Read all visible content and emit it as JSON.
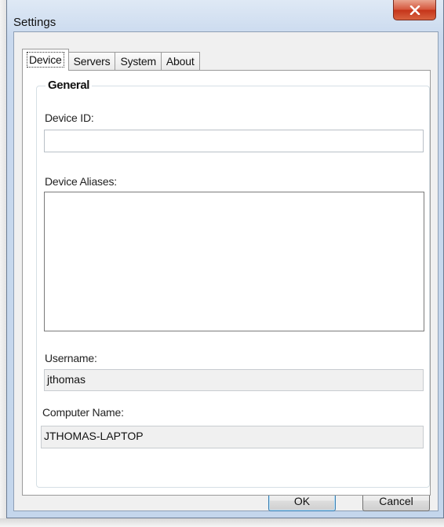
{
  "window": {
    "title": "Settings"
  },
  "tabs": [
    {
      "label": "Device",
      "active": true
    },
    {
      "label": "Servers",
      "active": false
    },
    {
      "label": "System",
      "active": false
    },
    {
      "label": "About",
      "active": false
    }
  ],
  "general": {
    "legend": "General",
    "device_id": {
      "label": "Device ID:",
      "value": ""
    },
    "device_aliases": {
      "label": "Device Aliases:",
      "value": ""
    },
    "username": {
      "label": "Username:",
      "value": "jthomas"
    },
    "computer_name": {
      "label": "Computer Name:",
      "value": "JTHOMAS-LAPTOP"
    }
  },
  "buttons": {
    "ok": "OK",
    "cancel": "Cancel"
  },
  "colors": {
    "close_button": "#c9391e",
    "default_button_border": "#3c7fb1"
  },
  "icons": {
    "close": "close-icon"
  }
}
